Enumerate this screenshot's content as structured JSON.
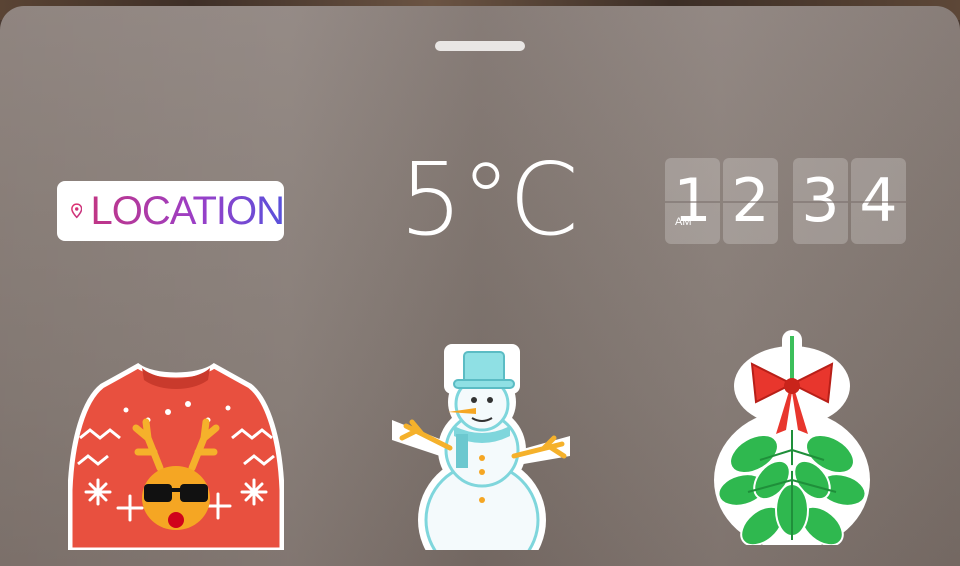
{
  "sheet": {
    "drag_handle": "drag-handle"
  },
  "stickers": {
    "location": {
      "label": "LOCATION",
      "icon": "location-pin-icon",
      "gradient": [
        "#c13584",
        "#5851db"
      ]
    },
    "temperature": {
      "value": "5°C"
    },
    "clock": {
      "digits": [
        "1",
        "2",
        "3",
        "4"
      ],
      "ampm": "AM"
    },
    "holiday": [
      {
        "name": "ugly-sweater-sticker",
        "color": "#e8503f"
      },
      {
        "name": "snowman-sticker",
        "color": "#7fd6dc"
      },
      {
        "name": "mistletoe-sticker",
        "color": "#3cbf5b"
      }
    ]
  }
}
